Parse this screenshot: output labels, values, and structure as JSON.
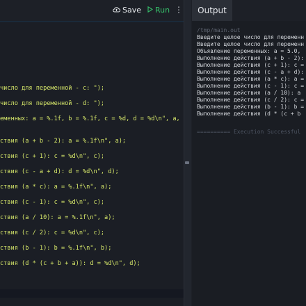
{
  "toolbar": {
    "save_label": "Save",
    "run_label": "Run"
  },
  "output_panel": {
    "tab_label": "Output",
    "path": "/tmp/main.out",
    "lines": [
      "Введите целое число для переменн",
      "Введите целое число для переменн",
      "Объявление переменных: a = 5.0,",
      "Выполнение действия (a + b - 2):",
      "Выполнение действия (c + 1): c =",
      "Выполнение действия (c - a + d):",
      "Выполнение действия (a * c): a =",
      "Выполнение действия (c - 1): c =",
      "Выполнение действия (a / 10): a",
      "Выполнение действия (c / 2): c =",
      "Выполнение действия (b - 1): b =",
      "Выполнение действия (d * (c + b"
    ],
    "success": "========== Execution Successful"
  },
  "editor": {
    "code_lines": [
      "число для переменной - c: \");",
      "число для переменной - d: \");",
      "еменных: a = %.1f, b = %.1f, c = %d, d = %d\\n\", a,",
      "ствия (a + b - 2): a = %.1f\\n\", a);",
      "ствия (c + 1): c = %d\\n\", c);",
      "ствия (c - a + d): d = %d\\n\", d);",
      "ствия (a * c): a = %.1f\\n\", a);",
      "ствия (c - 1): c = %d\\n\", c);",
      "ствия (a / 10): a = %.1f\\n\", a);",
      "ствия (c / 2): c = %d\\n\", c);",
      "ствия (b - 1): b = %.1f\\n\", b);",
      "ствия (d * (c + b + a)): d = %d\\n\", d);"
    ]
  }
}
